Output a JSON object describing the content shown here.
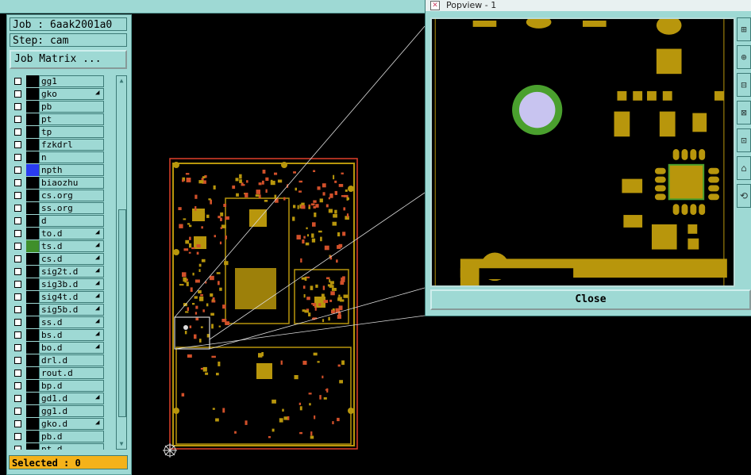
{
  "left_panel": {
    "job_label": "Job : 6aak2001a0",
    "step_label": "Step: cam",
    "job_matrix_button": "Job Matrix ...",
    "layers": [
      {
        "name": "gg1",
        "flag": "",
        "color": "#000000"
      },
      {
        "name": "gko",
        "flag": "◢",
        "color": "#000000"
      },
      {
        "name": "pb",
        "flag": "",
        "color": "#000000"
      },
      {
        "name": "pt",
        "flag": "",
        "color": "#000000"
      },
      {
        "name": "tp",
        "flag": "",
        "color": "#000000"
      },
      {
        "name": "fzkdrl",
        "flag": "",
        "color": "#000000"
      },
      {
        "name": "n",
        "flag": "",
        "color": "#000000"
      },
      {
        "name": "npth",
        "flag": "",
        "color": "#2a3cf0"
      },
      {
        "name": "biaozhu",
        "flag": "",
        "color": "#000000"
      },
      {
        "name": "cs.org",
        "flag": "",
        "color": "#000000"
      },
      {
        "name": "ss.org",
        "flag": "",
        "color": "#000000"
      },
      {
        "name": "d",
        "flag": "",
        "color": "#000000"
      },
      {
        "name": "to.d",
        "flag": "◢",
        "color": "#000000"
      },
      {
        "name": "ts.d",
        "flag": "◢",
        "color": "#3f8f2a"
      },
      {
        "name": "cs.d",
        "flag": "◢",
        "color": "#000000"
      },
      {
        "name": "sig2t.d",
        "flag": "◢",
        "color": "#000000"
      },
      {
        "name": "sig3b.d",
        "flag": "◢",
        "color": "#000000"
      },
      {
        "name": "sig4t.d",
        "flag": "◢",
        "color": "#000000"
      },
      {
        "name": "sig5b.d",
        "flag": "◢",
        "color": "#000000"
      },
      {
        "name": "ss.d",
        "flag": "◢",
        "color": "#000000"
      },
      {
        "name": "bs.d",
        "flag": "◢",
        "color": "#000000"
      },
      {
        "name": "bo.d",
        "flag": "◢",
        "color": "#000000"
      },
      {
        "name": "drl.d",
        "flag": "",
        "color": "#000000"
      },
      {
        "name": "rout.d",
        "flag": "",
        "color": "#000000"
      },
      {
        "name": "bp.d",
        "flag": "",
        "color": "#000000"
      },
      {
        "name": "gd1.d",
        "flag": "◢",
        "color": "#000000"
      },
      {
        "name": "gg1.d",
        "flag": "",
        "color": "#000000"
      },
      {
        "name": "gko.d",
        "flag": "◢",
        "color": "#000000"
      },
      {
        "name": "pb.d",
        "flag": "",
        "color": "#000000"
      },
      {
        "name": "pt.d",
        "flag": "",
        "color": "#000000"
      }
    ],
    "selected_label": "Selected : 0"
  },
  "popview": {
    "title": "Popview - 1",
    "close_button": "Close",
    "tools": [
      "zoom-in-icon",
      "zoom-out-icon",
      "pan-icon",
      "fit-icon",
      "measure-icon",
      "home-icon",
      "rotate-icon"
    ]
  },
  "colors": {
    "panel": "#9ed9d4",
    "copper": "#b8960c",
    "outline": "#e0402a",
    "mask": "#4aa02e",
    "hole": "#c8c4f0",
    "selected": "#f4b21a"
  }
}
